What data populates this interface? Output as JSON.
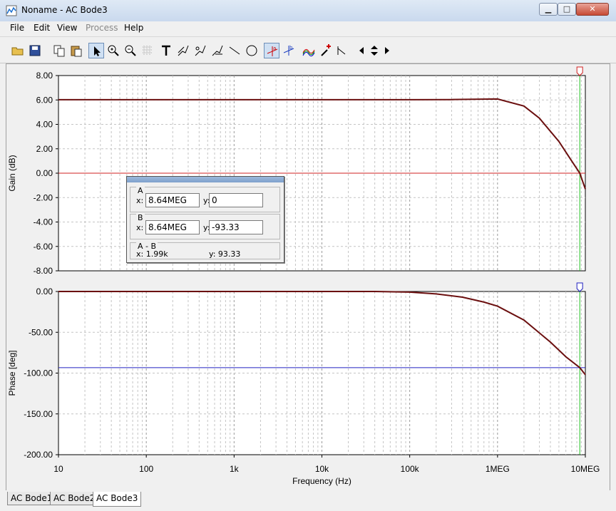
{
  "window": {
    "title": "Noname - AC Bode3"
  },
  "menu": [
    "File",
    "Edit",
    "View",
    "Process",
    "Help"
  ],
  "toolbar_icons": [
    "open-icon",
    "save-icon",
    "copy-icon",
    "paste-icon",
    "pointer-icon",
    "zoom-in-icon",
    "zoom-out-icon",
    "grid-icon",
    "text-icon",
    "probe-icon",
    "probe-icon",
    "probe-icon",
    "line-icon",
    "circle-icon",
    "cursor-a-icon",
    "cursor-b-icon",
    "waveforms-icon",
    "pick-icon",
    "marker-icon",
    "nav-left-icon",
    "nav-updown-icon",
    "nav-right-icon"
  ],
  "cursor_panel": {
    "a_title": "A",
    "a_x_label": "x:",
    "a_x": "8.64MEG",
    "a_y_label": "y:",
    "a_y": "0",
    "b_title": "B",
    "b_x_label": "x:",
    "b_x": "8.64MEG",
    "b_y_label": "y:",
    "b_y": "-93.33",
    "diff_title": "A - B",
    "diff_x": "x:   1.99k",
    "diff_y": "y: 93.33"
  },
  "tabs": [
    "AC Bode1",
    "AC Bode2",
    "AC Bode3"
  ],
  "chart_data": [
    {
      "type": "line",
      "ylabel": "Gain (dB)",
      "yticks": [
        "8.00",
        "6.00",
        "4.00",
        "2.00",
        "0.00",
        "-2.00",
        "-4.00",
        "-6.00",
        "-8.00"
      ],
      "ylim": [
        -8,
        8
      ],
      "xscale": "log",
      "xlim": [
        10,
        10000000
      ],
      "series": [
        {
          "color": "#6b0f0f",
          "x": [
            10,
            100,
            1000,
            10000,
            100000,
            300000,
            1000000,
            2000000,
            3000000,
            5000000,
            7000000,
            8640000,
            10000000
          ],
          "y": [
            6.02,
            6.02,
            6.02,
            6.02,
            6.02,
            6.03,
            6.08,
            5.5,
            4.5,
            2.6,
            1.0,
            0.0,
            -1.3
          ]
        }
      ],
      "cursor_a_y": 0,
      "cursor_x": 8640000
    },
    {
      "type": "line",
      "xlabel": "Frequency (Hz)",
      "ylabel": "Phase [deg]",
      "yticks": [
        "0.00",
        "-50.00",
        "-100.00",
        "-150.00",
        "-200.00"
      ],
      "ylim": [
        -200,
        0
      ],
      "xscale": "log",
      "xlim": [
        10,
        10000000
      ],
      "xticks": [
        "10",
        "100",
        "1k",
        "10k",
        "100k",
        "1MEG",
        "10MEG"
      ],
      "series": [
        {
          "color": "#6b0f0f",
          "x": [
            10,
            10000,
            40000,
            100000,
            200000,
            400000,
            700000,
            1000000,
            2000000,
            4000000,
            6000000,
            8640000,
            10000000
          ],
          "y": [
            0,
            0,
            0,
            -0.8,
            -3,
            -7,
            -13,
            -18,
            -35,
            -62,
            -80,
            -93.33,
            -102
          ]
        }
      ],
      "cursor_b_y": -93.33,
      "cursor_x": 8640000
    }
  ]
}
